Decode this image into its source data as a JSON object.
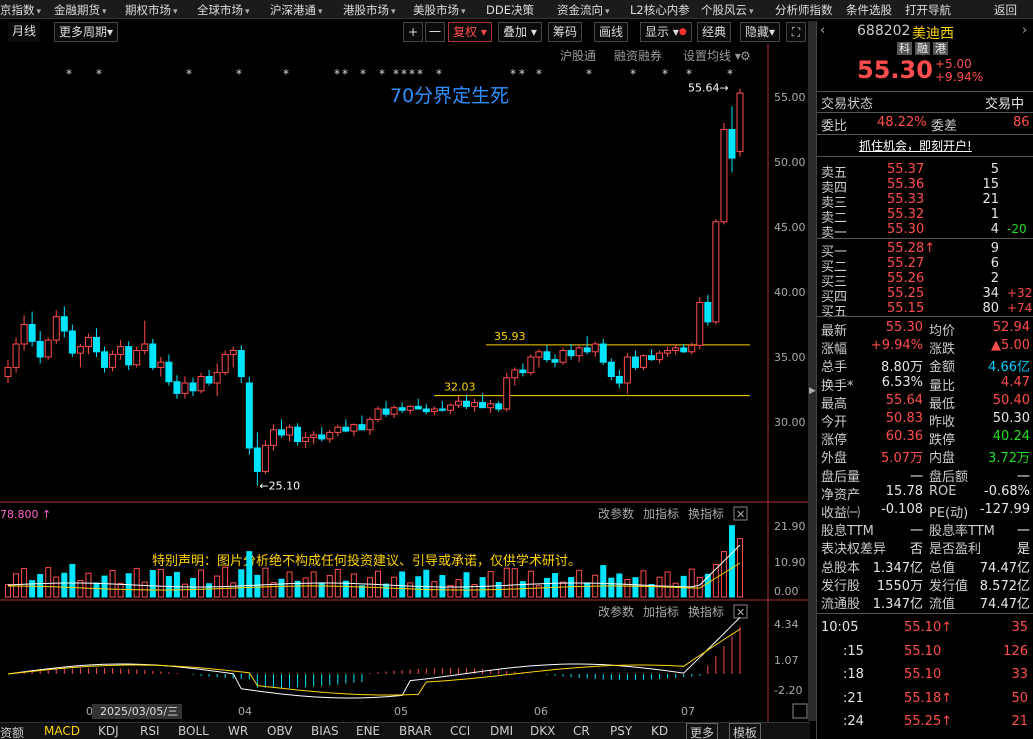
{
  "top_menu": [
    {
      "label": "京指数",
      "dd": true
    },
    {
      "label": "金融期货",
      "dd": true
    },
    {
      "label": "期权市场",
      "dd": true
    },
    {
      "label": "全球市场",
      "dd": true
    },
    {
      "label": "沪深港通",
      "dd": true
    },
    {
      "label": "港股市场",
      "dd": true
    },
    {
      "label": "美股市场",
      "dd": true
    },
    {
      "label": "DDE决策",
      "dd": false
    },
    {
      "label": "资金流向",
      "dd": true
    },
    {
      "label": "L2核心内参",
      "dd": false
    },
    {
      "label": "个股风云",
      "dd": true
    },
    {
      "label": "分析师指数",
      "dd": false
    },
    {
      "label": "条件选股",
      "dd": false
    },
    {
      "label": "打开导航",
      "dd": false
    },
    {
      "label": "返回",
      "dd": false
    }
  ],
  "toolbar": {
    "period_month": "月线",
    "period_more": "更多周期",
    "plus": "+",
    "minus": "一",
    "fuquan": "复权",
    "overlay": "叠加",
    "chips": "筹码",
    "draw": "画线",
    "display": "显示",
    "classic": "经典",
    "hide": "隐藏",
    "expand": "⛶"
  },
  "chart_header": {
    "hkconnect": "沪股通",
    "margin": "融资融券",
    "settings": "设置均线"
  },
  "chart_title": "70分界定生死",
  "price_axis": [
    "55.00",
    "50.00",
    "45.00",
    "40.00",
    "35.00",
    "30.00"
  ],
  "annotations": {
    "high": "55.64",
    "low": "25.10",
    "line1": "35.93",
    "line2": "32.03"
  },
  "volume_panel": {
    "top_value": "78.800",
    "params": "改参数",
    "add": "加指标",
    "switch": "换指标",
    "axis": [
      "21.90",
      "10.90",
      "0.00"
    ],
    "disclaimer": "特别声明：图片分析绝不构成任何投资建议、引导或承诺，仅供学术研讨。"
  },
  "macd_panel": {
    "params": "改参数",
    "add": "加指标",
    "switch": "换指标",
    "axis": [
      "4.34",
      "1.07",
      "-2.20"
    ]
  },
  "time_axis": {
    "labels": [
      "03",
      "04",
      "05",
      "06",
      "07"
    ],
    "cursor_date": "2025/03/05/三"
  },
  "bottom_tabs": [
    "资额",
    "MACD",
    "KDJ",
    "RSI",
    "BOLL",
    "WR",
    "OBV",
    "BIAS",
    "ENE",
    "BRAR",
    "CCI",
    "DMI",
    "DKX",
    "CR",
    "PSY",
    "KD",
    "更多",
    "模板"
  ],
  "stock": {
    "code": "688202",
    "name": "美迪西",
    "tags": [
      "科",
      "融",
      "港"
    ],
    "price": "55.30",
    "change": "+5.00",
    "change_pct": "+9.94%",
    "trade_status_label": "交易状态",
    "trade_status": "交易中",
    "weibi_label": "委比",
    "weibi": "48.22%",
    "weicha_label": "委差",
    "weicha": "86",
    "promo": "抓住机会，即刻开户!"
  },
  "sell_orders": [
    {
      "label": "卖五",
      "price": "55.37",
      "vol": "5",
      "chg": ""
    },
    {
      "label": "卖四",
      "price": "55.36",
      "vol": "15",
      "chg": ""
    },
    {
      "label": "卖三",
      "price": "55.33",
      "vol": "21",
      "chg": ""
    },
    {
      "label": "卖二",
      "price": "55.32",
      "vol": "1",
      "chg": ""
    },
    {
      "label": "卖一",
      "price": "55.30",
      "vol": "4",
      "chg": "-20"
    }
  ],
  "buy_orders": [
    {
      "label": "买一",
      "price": "55.28",
      "arrow": "🠕",
      "vol": "9",
      "chg": ""
    },
    {
      "label": "买二",
      "price": "55.27",
      "arrow": "",
      "vol": "6",
      "chg": ""
    },
    {
      "label": "买三",
      "price": "55.26",
      "arrow": "",
      "vol": "2",
      "chg": ""
    },
    {
      "label": "买四",
      "price": "55.25",
      "arrow": "",
      "vol": "34",
      "chg": "+32"
    },
    {
      "label": "买五",
      "price": "55.15",
      "arrow": "",
      "vol": "80",
      "chg": "+74"
    }
  ],
  "stats": [
    {
      "l1": "最新",
      "v1": "55.30",
      "c1": "r",
      "l2": "均价",
      "v2": "52.94",
      "c2": "r"
    },
    {
      "l1": "涨幅",
      "v1": "+9.94%",
      "c1": "r",
      "l2": "涨跌",
      "v2": "▲5.00",
      "c2": "r"
    },
    {
      "l1": "总手",
      "v1": "8.80万",
      "c1": "w",
      "l2": "金额",
      "v2": "4.66亿",
      "c2": "c"
    },
    {
      "l1": "换手*",
      "v1": "6.53%",
      "c1": "w",
      "l2": "量比",
      "v2": "4.47",
      "c2": "r"
    },
    {
      "l1": "最高",
      "v1": "55.64",
      "c1": "r",
      "l2": "最低",
      "v2": "50.40",
      "c2": "r"
    },
    {
      "l1": "今开",
      "v1": "50.83",
      "c1": "r",
      "l2": "昨收",
      "v2": "50.30",
      "c2": "w"
    },
    {
      "l1": "涨停",
      "v1": "60.36",
      "c1": "r",
      "l2": "跌停",
      "v2": "40.24",
      "c2": "g"
    },
    {
      "l1": "外盘",
      "v1": "5.07万",
      "c1": "r",
      "l2": "内盘",
      "v2": "3.72万",
      "c2": "g"
    },
    {
      "l1": "盘后量",
      "v1": "一",
      "c1": "w",
      "l2": "盘后额",
      "v2": "一",
      "c2": "w"
    },
    {
      "l1": "净资产",
      "v1": "15.78",
      "c1": "w",
      "l2": "ROE",
      "v2": "-0.68%",
      "c2": "w"
    },
    {
      "l1": "收益㈠",
      "v1": "-0.108",
      "c1": "w",
      "l2": "PE(动)",
      "v2": "-127.99",
      "c2": "w"
    },
    {
      "l1": "股息TTM",
      "v1": "一",
      "c1": "w",
      "l2": "股息率TTM",
      "v2": "一",
      "c2": "w"
    },
    {
      "l1": "表决权差异",
      "v1": "否",
      "c1": "w",
      "l2": "是否盈利",
      "v2": "是",
      "c2": "w"
    },
    {
      "l1": "总股本",
      "v1": "1.347亿",
      "c1": "w",
      "l2": "总值",
      "v2": "74.47亿",
      "c2": "w"
    },
    {
      "l1": "发行股",
      "v1": "1550万",
      "c1": "w",
      "l2": "发行值",
      "v2": "8.572亿",
      "c2": "w"
    },
    {
      "l1": "流通股",
      "v1": "1.347亿",
      "c1": "w",
      "l2": "流值",
      "v2": "74.47亿",
      "c2": "w"
    }
  ],
  "ticks": [
    {
      "time": "10:05",
      "price": "55.10",
      "arrow": "↑",
      "vol": "35"
    },
    {
      "time": ":15",
      "price": "55.10",
      "arrow": "",
      "vol": "126"
    },
    {
      "time": ":18",
      "price": "55.10",
      "arrow": "",
      "vol": "33"
    },
    {
      "time": ":21",
      "price": "55.18",
      "arrow": "↑",
      "vol": "50"
    },
    {
      "time": ":24",
      "price": "55.25",
      "arrow": "↑",
      "vol": "21"
    }
  ],
  "colors": {
    "up": "#ff4d4d",
    "down": "#00e5ff",
    "bg": "#000000",
    "yellow": "#ffd400",
    "title": "#2f8fff"
  },
  "candles": [
    [
      33.5,
      34.8,
      33.0,
      34.2
    ],
    [
      34.2,
      36.5,
      33.8,
      36.0
    ],
    [
      36.0,
      38.2,
      35.5,
      37.5
    ],
    [
      37.5,
      38.5,
      35.8,
      36.2
    ],
    [
      36.2,
      37.0,
      34.5,
      35.0
    ],
    [
      35.0,
      36.5,
      34.8,
      36.3
    ],
    [
      36.3,
      38.6,
      36.0,
      38.1
    ],
    [
      38.1,
      38.9,
      36.5,
      37.0
    ],
    [
      37.0,
      37.5,
      35.0,
      35.3
    ],
    [
      35.3,
      36.0,
      34.2,
      35.8
    ],
    [
      35.8,
      36.8,
      35.2,
      36.5
    ],
    [
      36.5,
      37.2,
      35.0,
      35.4
    ],
    [
      35.4,
      35.8,
      33.8,
      34.2
    ],
    [
      34.2,
      35.5,
      33.9,
      35.2
    ],
    [
      35.2,
      36.3,
      34.8,
      35.8
    ],
    [
      35.8,
      36.2,
      34.0,
      34.4
    ],
    [
      34.4,
      35.8,
      34.2,
      35.5
    ],
    [
      35.5,
      37.8,
      35.2,
      36.0
    ],
    [
      36.0,
      36.4,
      34.0,
      34.2
    ],
    [
      34.2,
      35.0,
      33.5,
      34.6
    ],
    [
      34.6,
      35.2,
      32.8,
      33.1
    ],
    [
      33.1,
      33.6,
      31.8,
      32.2
    ],
    [
      32.2,
      33.5,
      31.8,
      33.0
    ],
    [
      33.0,
      33.4,
      32.0,
      32.4
    ],
    [
      32.4,
      33.8,
      32.2,
      33.5
    ],
    [
      33.5,
      34.0,
      32.8,
      33.0
    ],
    [
      33.0,
      34.5,
      32.0,
      33.8
    ],
    [
      33.8,
      35.5,
      33.6,
      35.2
    ],
    [
      35.2,
      35.8,
      34.2,
      35.5
    ],
    [
      35.5,
      35.9,
      33.0,
      33.5
    ],
    [
      33.0,
      33.5,
      27.5,
      28.0
    ],
    [
      28.0,
      29.2,
      25.1,
      26.2
    ],
    [
      26.2,
      28.6,
      26.0,
      28.2
    ],
    [
      28.2,
      29.8,
      27.8,
      29.4
    ],
    [
      29.4,
      30.2,
      28.8,
      29.0
    ],
    [
      29.0,
      29.8,
      28.5,
      29.6
    ],
    [
      29.6,
      29.9,
      28.2,
      28.5
    ],
    [
      28.5,
      29.2,
      28.0,
      28.8
    ],
    [
      28.8,
      29.3,
      28.3,
      29.0
    ],
    [
      29.0,
      29.6,
      28.5,
      28.7
    ],
    [
      28.7,
      29.4,
      28.4,
      29.2
    ],
    [
      29.2,
      29.8,
      28.9,
      29.6
    ],
    [
      29.6,
      30.2,
      29.2,
      29.3
    ],
    [
      29.3,
      29.9,
      28.9,
      29.8
    ],
    [
      29.8,
      30.5,
      29.5,
      29.4
    ],
    [
      29.4,
      30.4,
      29.0,
      30.2
    ],
    [
      30.2,
      31.2,
      30.0,
      31.0
    ],
    [
      31.0,
      31.6,
      30.4,
      30.6
    ],
    [
      30.6,
      31.3,
      30.3,
      31.1
    ],
    [
      31.1,
      31.5,
      30.7,
      30.9
    ],
    [
      30.9,
      31.3,
      30.6,
      31.2
    ],
    [
      31.2,
      31.8,
      31.0,
      31.0
    ],
    [
      31.0,
      31.4,
      30.6,
      30.8
    ],
    [
      30.8,
      31.2,
      30.5,
      31.0
    ],
    [
      31.0,
      31.6,
      30.8,
      30.9
    ],
    [
      30.9,
      31.4,
      30.6,
      31.3
    ],
    [
      31.3,
      32.0,
      31.1,
      31.6
    ],
    [
      31.6,
      32.1,
      31.0,
      31.2
    ],
    [
      31.2,
      31.8,
      30.8,
      31.5
    ],
    [
      31.5,
      32.2,
      31.3,
      31.1
    ],
    [
      31.1,
      31.7,
      30.7,
      31.4
    ],
    [
      31.4,
      31.6,
      30.8,
      31.0
    ],
    [
      31.0,
      33.8,
      30.8,
      33.4
    ],
    [
      33.4,
      34.2,
      32.8,
      34.0
    ],
    [
      34.0,
      34.5,
      33.5,
      33.8
    ],
    [
      33.8,
      35.2,
      33.6,
      35.0
    ],
    [
      35.0,
      35.6,
      34.2,
      35.4
    ],
    [
      35.4,
      35.9,
      34.6,
      34.8
    ],
    [
      34.8,
      35.2,
      34.2,
      34.6
    ],
    [
      34.6,
      35.7,
      34.4,
      35.5
    ],
    [
      35.5,
      36.0,
      34.8,
      35.1
    ],
    [
      35.1,
      35.9,
      34.6,
      35.7
    ],
    [
      35.7,
      36.6,
      35.2,
      35.4
    ],
    [
      35.4,
      36.2,
      35.0,
      36.0
    ],
    [
      36.0,
      36.4,
      34.4,
      34.6
    ],
    [
      34.6,
      34.9,
      33.2,
      33.5
    ],
    [
      33.5,
      34.0,
      32.6,
      33.0
    ],
    [
      33.0,
      35.3,
      32.2,
      35.0
    ],
    [
      35.0,
      35.5,
      34.0,
      34.2
    ],
    [
      34.2,
      35.2,
      34.0,
      35.1
    ],
    [
      35.1,
      35.6,
      34.7,
      34.8
    ],
    [
      34.8,
      35.5,
      34.5,
      35.3
    ],
    [
      35.3,
      35.8,
      35.0,
      35.5
    ],
    [
      35.5,
      36.0,
      35.2,
      35.7
    ],
    [
      35.7,
      36.0,
      35.3,
      35.4
    ],
    [
      35.4,
      36.1,
      35.2,
      35.9
    ],
    [
      35.9,
      39.6,
      35.6,
      39.2
    ],
    [
      39.2,
      39.8,
      37.4,
      37.7
    ],
    [
      37.7,
      45.6,
      37.5,
      45.4
    ],
    [
      45.4,
      53.0,
      45.2,
      52.5
    ],
    [
      52.5,
      54.3,
      49.2,
      50.3
    ],
    [
      50.8,
      55.64,
      50.4,
      55.3
    ]
  ]
}
